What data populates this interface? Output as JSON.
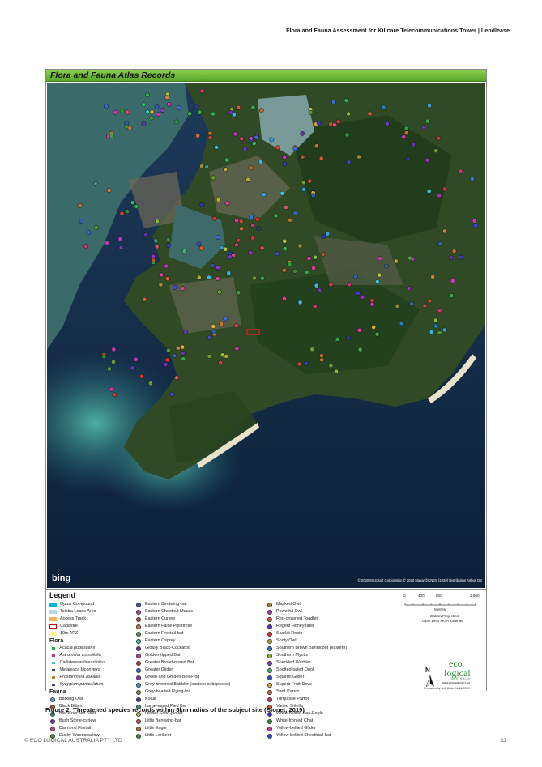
{
  "header": {
    "text": "Flora and Fauna Assessment for Killcare Telecommunications Tower | Lendlease"
  },
  "figure": {
    "title": "Flora and Fauna Atlas Records",
    "bing": "bing",
    "copyright": "© 2020 Microsoft Corporation © 2020 Maxar ©CNES (2020) Distribution Airbus DS"
  },
  "legend": {
    "title": "Legend",
    "layers": [
      {
        "label": "Optus Compound",
        "color": "#00b4e6"
      },
      {
        "label": "Telstra Lease Area",
        "color": "#b7d7e8"
      },
      {
        "label": "Access Track",
        "color": "#f2b05a"
      },
      {
        "label": "Cadastre",
        "color": "#c00000"
      },
      {
        "label": "10m APZ",
        "color": "#fff7a0"
      }
    ],
    "flora_heading": "Flora",
    "flora": [
      {
        "label": "Acacia pubescens",
        "color": "#2ea84b"
      },
      {
        "label": "Astrotricha crassifolia",
        "color": "#c0396b"
      },
      {
        "label": "Callistemon linearifolius",
        "color": "#3fbfcf"
      },
      {
        "label": "Melaleuca biconvexa",
        "color": "#2c3e9c"
      },
      {
        "label": "Prostanthera askania",
        "color": "#b58a2a"
      },
      {
        "label": "Syzygium paniculatum",
        "color": "#4a3f9a"
      }
    ],
    "fauna_heading": "Fauna",
    "fauna_col1": [
      {
        "label": "Barking Owl",
        "color": "#3fb6d8"
      },
      {
        "label": "Black Bittern",
        "color": "#b5532a"
      },
      {
        "label": "Black-necked Stork",
        "color": "#2ea84b"
      },
      {
        "label": "Bush Stone-curlew",
        "color": "#6a3fb0"
      },
      {
        "label": "Diamond Firetail",
        "color": "#d8408a"
      },
      {
        "label": "Dusky Woodswallow",
        "color": "#4f9a3a"
      }
    ],
    "fauna_col2": [
      {
        "label": "Eastern Bentwing-bat",
        "color": "#2f5fb0"
      },
      {
        "label": "Eastern Chestnut Mouse",
        "color": "#c03aa8"
      },
      {
        "label": "Eastern Curlew",
        "color": "#c8463a"
      },
      {
        "label": "Eastern False Pipistrelle",
        "color": "#c8823a"
      },
      {
        "label": "Eastern Freetail-bat",
        "color": "#3aa84a"
      },
      {
        "label": "Eastern Osprey",
        "color": "#3ac8c0"
      },
      {
        "label": "Glossy Black-Cockatoo",
        "color": "#6a2fb0"
      },
      {
        "label": "Golden-tipped Bat",
        "color": "#d83aa0"
      },
      {
        "label": "Greater Broad-nosed Bat",
        "color": "#c83a3a"
      },
      {
        "label": "Greater Glider",
        "color": "#3a6ad8"
      },
      {
        "label": "Green and Golden Bell Frog",
        "color": "#9a2fb8"
      },
      {
        "label": "Grey-crowned Babbler (eastern subspecies)",
        "color": "#3a9ad8"
      },
      {
        "label": "Grey-headed Flying-fox",
        "color": "#6a9a3a"
      },
      {
        "label": "Koala",
        "color": "#2a3a9a"
      },
      {
        "label": "Large-eared Pied Bat",
        "color": "#3a9a7a"
      },
      {
        "label": "Lesser Sand-plover",
        "color": "#b8c83a"
      },
      {
        "label": "Little Bentwing-bat",
        "color": "#d8506a"
      },
      {
        "label": "Little Eagle",
        "color": "#b8702a"
      },
      {
        "label": "Little Lorikeet",
        "color": "#2a9a3a"
      }
    ],
    "fauna_col3": [
      {
        "label": "Masked Owl",
        "color": "#9a8a3a"
      },
      {
        "label": "Powerful Owl",
        "color": "#b03ab0"
      },
      {
        "label": "Red-crowned Toadlet",
        "color": "#d85a3a"
      },
      {
        "label": "Regent Honeyeater",
        "color": "#5a3ab0"
      },
      {
        "label": "Scarlet Robin",
        "color": "#d8302a"
      },
      {
        "label": "Sooty Owl",
        "color": "#b8a83a"
      },
      {
        "label": "Southern Brown Bandicoot (eastern)",
        "color": "#2a7ac8"
      },
      {
        "label": "Southern Myotis",
        "color": "#8ab83a"
      },
      {
        "label": "Speckled Warbler",
        "color": "#8a3ac8"
      },
      {
        "label": "Spotted-tailed Quoll",
        "color": "#3ab86a"
      },
      {
        "label": "Squirrel Glider",
        "color": "#3a4ab8"
      },
      {
        "label": "Superb Fruit-Dove",
        "color": "#d8b03a"
      },
      {
        "label": "Swift Parrot",
        "color": "#c8703a"
      },
      {
        "label": "Turquoise Parrot",
        "color": "#c83a6a"
      },
      {
        "label": "Varied Sittella",
        "color": "#c8603a"
      },
      {
        "label": "White-bellied Sea-Eagle",
        "color": "#3a3ac8"
      },
      {
        "label": "White-fronted Chat",
        "color": "#3a8a3a"
      },
      {
        "label": "Yellow-bellied Glider",
        "color": "#c83ab0"
      },
      {
        "label": "Yellow-bellied Sheathtail-bat",
        "color": "#3a4ad8"
      }
    ],
    "scale": {
      "ticks": [
        "0",
        "400",
        "800",
        "1,600"
      ],
      "unit": "Metres",
      "datum_label": "Datum/Projection:",
      "datum": "GDA 1994 MGA Zone 56"
    },
    "north": "N",
    "logo": {
      "eco": "eco",
      "logical": "logical",
      "au": "AUSTRALIA",
      "url": "www.ecoaus.com.au"
    },
    "prepared": "Prepared by: LG   Date:24/11/2020"
  },
  "caption": "Figure 2: Threatened species records within 5km radius of the subject site (Bionet, 2019)",
  "footer": {
    "left": "© ECO LOGICAL AUSTRALIA PTY LTD",
    "page": "11"
  }
}
